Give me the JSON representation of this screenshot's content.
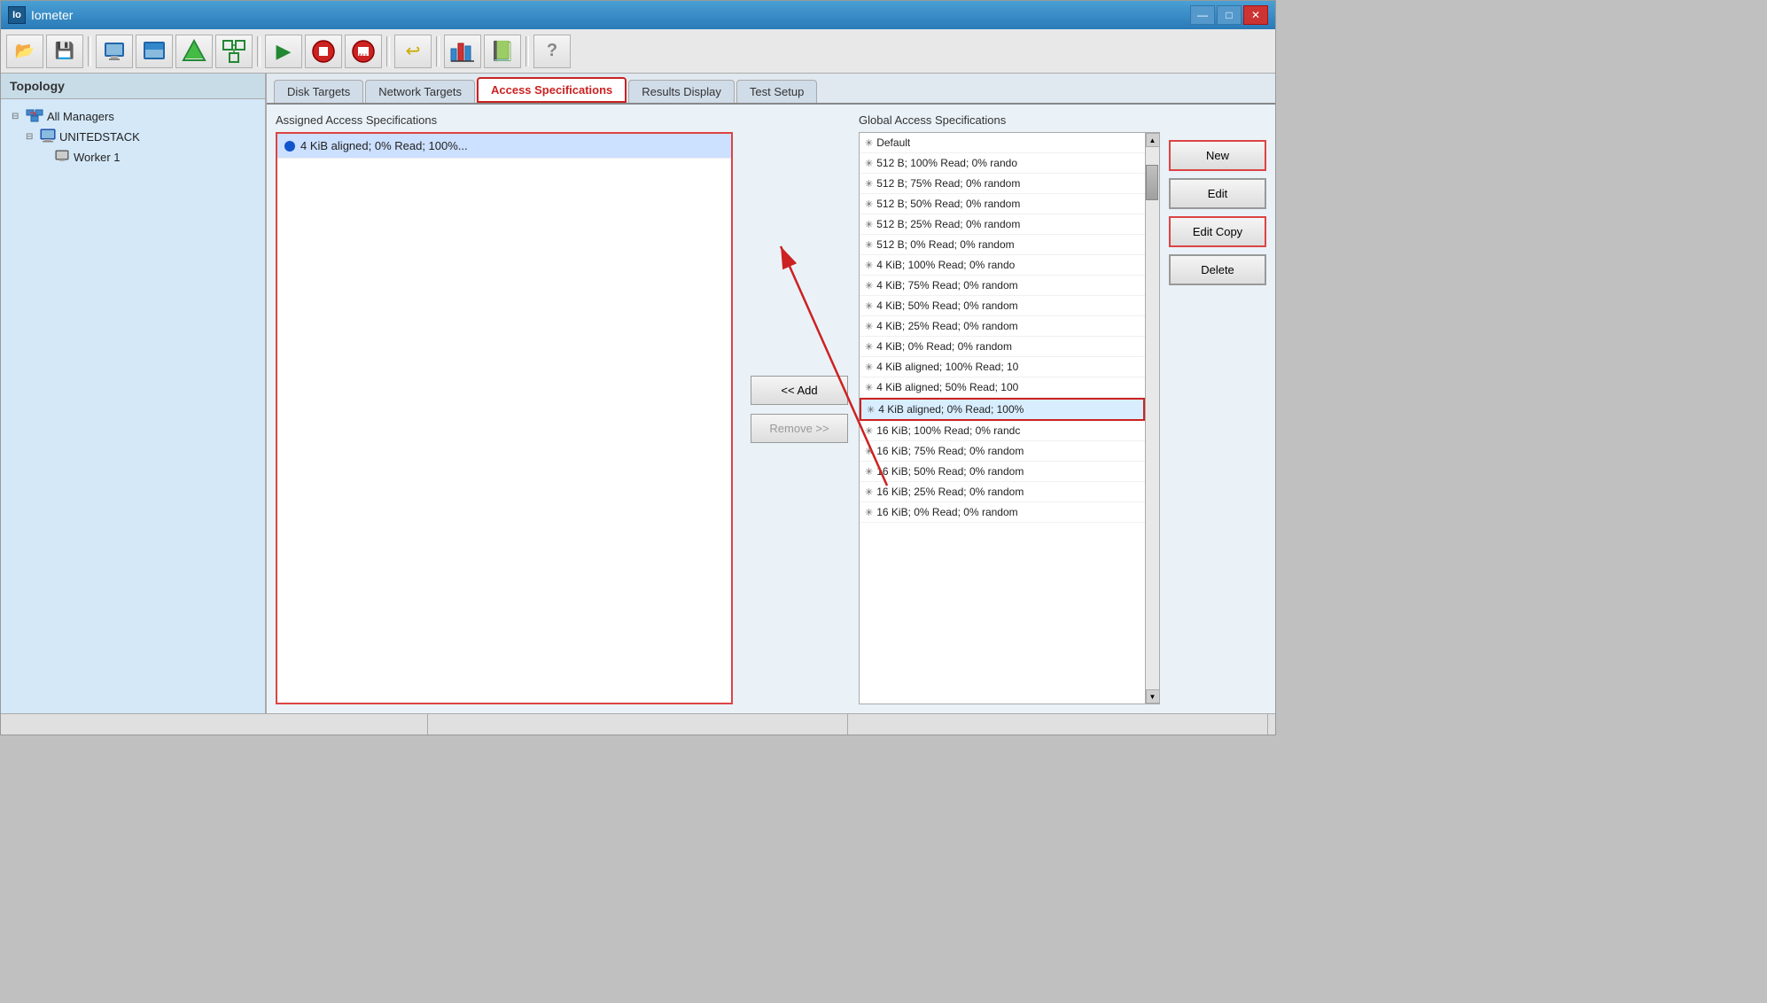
{
  "window": {
    "title": "Iometer",
    "app_icon": "Io",
    "minimize_label": "—",
    "maximize_label": "□",
    "close_label": "✕"
  },
  "toolbar": {
    "buttons": [
      {
        "name": "open-button",
        "icon": "📂",
        "tooltip": "Open"
      },
      {
        "name": "save-button",
        "icon": "💾",
        "tooltip": "Save"
      },
      {
        "name": "display-button",
        "icon": "🖥",
        "tooltip": "Display"
      },
      {
        "name": "config-button",
        "icon": "⬛",
        "tooltip": "Config"
      },
      {
        "name": "network-button",
        "icon": "🔧",
        "tooltip": "Network"
      },
      {
        "name": "topology-button",
        "icon": "📋",
        "tooltip": "Topology"
      },
      {
        "name": "start-button",
        "icon": "▶",
        "tooltip": "Start"
      },
      {
        "name": "stop-button",
        "icon": "⛔",
        "tooltip": "Stop"
      },
      {
        "name": "stopall-button",
        "icon": "🛑",
        "tooltip": "Stop All"
      },
      {
        "name": "reset-button",
        "icon": "↩",
        "tooltip": "Reset"
      },
      {
        "name": "bar-chart-button",
        "icon": "📊",
        "tooltip": "Bar Chart"
      },
      {
        "name": "book-button",
        "icon": "📗",
        "tooltip": "Book"
      },
      {
        "name": "help-button",
        "icon": "❓",
        "tooltip": "Help"
      }
    ]
  },
  "sidebar": {
    "header": "Topology",
    "tree": {
      "root": {
        "label": "All Managers",
        "icon": "network",
        "expanded": true,
        "children": [
          {
            "label": "UNITEDSTACK",
            "icon": "computer",
            "expanded": true,
            "children": [
              {
                "label": "Worker 1",
                "icon": "worker"
              }
            ]
          }
        ]
      }
    }
  },
  "tabs": [
    {
      "label": "Disk Targets",
      "active": false
    },
    {
      "label": "Network Targets",
      "active": false
    },
    {
      "label": "Access Specifications",
      "active": true
    },
    {
      "label": "Results Display",
      "active": false
    },
    {
      "label": "Test Setup",
      "active": false
    }
  ],
  "assigned_panel": {
    "header": "Assigned Access Specifications",
    "items": [
      {
        "label": "4 KiB aligned; 0% Read; 100%...",
        "selected": true,
        "dot_color": "#1155cc"
      }
    ]
  },
  "add_button": "<< Add",
  "remove_button": "Remove >>",
  "global_panel": {
    "header": "Global Access Specifications",
    "items": [
      {
        "label": "Default",
        "selected": false
      },
      {
        "label": "512 B; 100% Read; 0% rando",
        "selected": false
      },
      {
        "label": "512 B; 75% Read; 0% random",
        "selected": false
      },
      {
        "label": "512 B; 50% Read; 0% random",
        "selected": false
      },
      {
        "label": "512 B; 25% Read; 0% random",
        "selected": false
      },
      {
        "label": "512 B; 0% Read; 0% random",
        "selected": false
      },
      {
        "label": "4 KiB; 100% Read; 0% rando",
        "selected": false
      },
      {
        "label": "4 KiB; 75% Read; 0% random",
        "selected": false
      },
      {
        "label": "4 KiB; 50% Read; 0% random",
        "selected": false
      },
      {
        "label": "4 KiB; 25% Read; 0% random",
        "selected": false
      },
      {
        "label": "4 KiB; 0% Read; 0% random",
        "selected": false
      },
      {
        "label": "4 KiB aligned; 100% Read; 10",
        "selected": false
      },
      {
        "label": "4 KiB aligned; 50% Read; 100",
        "selected": false
      },
      {
        "label": "4 KiB aligned; 0% Read; 100%",
        "selected": true
      },
      {
        "label": "16 KiB; 100% Read; 0% randc",
        "selected": false
      },
      {
        "label": "16 KiB; 75% Read; 0% random",
        "selected": false
      },
      {
        "label": "16 KiB; 50% Read; 0% random",
        "selected": false
      },
      {
        "label": "16 KiB; 25% Read; 0% random",
        "selected": false
      },
      {
        "label": "16 KiB; 0% Read; 0% random",
        "selected": false
      }
    ]
  },
  "action_buttons": {
    "new_label": "New",
    "edit_label": "Edit",
    "edit_copy_label": "Edit Copy",
    "delete_label": "Delete"
  },
  "status_bar": {
    "sections": [
      "",
      "",
      ""
    ]
  }
}
